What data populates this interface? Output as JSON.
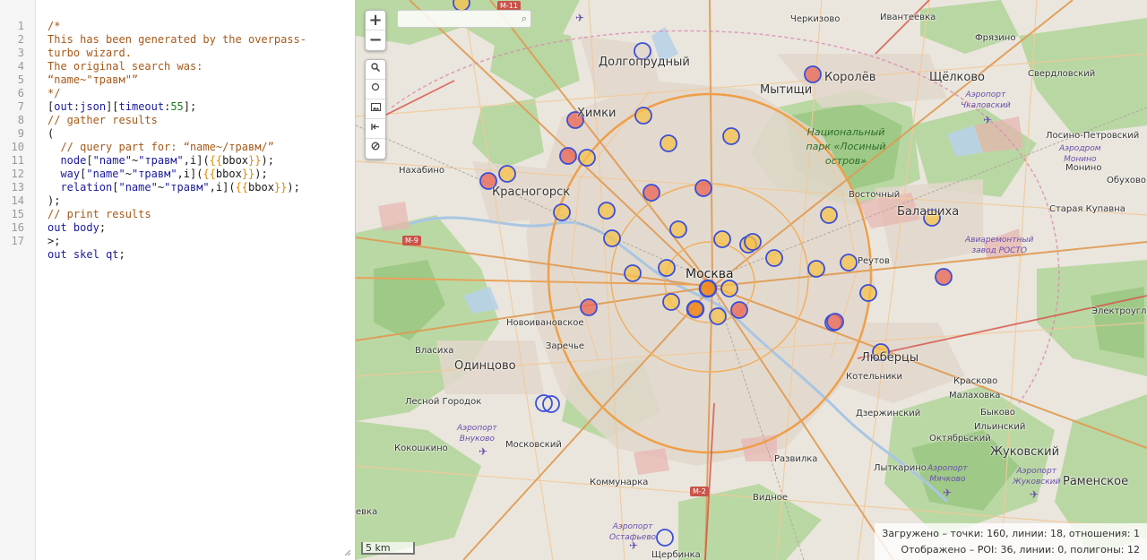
{
  "editor": {
    "line_numbers": [
      "1",
      "2",
      "3",
      "4",
      "5",
      "6",
      "7",
      "8",
      "9",
      "10",
      "11",
      "12",
      "13",
      "14",
      "15",
      "16",
      "17"
    ],
    "lines": [
      [
        {
          "t": "c",
          "v": "/*"
        }
      ],
      [
        {
          "t": "c",
          "v": "This has been generated by the overpass-"
        }
      ],
      [
        {
          "t": "c",
          "v": "turbo wizard."
        }
      ],
      [
        {
          "t": "c",
          "v": "The original search was:"
        }
      ],
      [
        {
          "t": "c",
          "v": "“name~\"травм\"”"
        }
      ],
      [
        {
          "t": "c",
          "v": "*/"
        }
      ],
      [
        {
          "t": "t",
          "v": "["
        },
        {
          "t": "k",
          "v": "out"
        },
        {
          "t": "t",
          "v": ":"
        },
        {
          "t": "k",
          "v": "json"
        },
        {
          "t": "t",
          "v": "]["
        },
        {
          "t": "k",
          "v": "timeout"
        },
        {
          "t": "t",
          "v": ":"
        },
        {
          "t": "n",
          "v": "55"
        },
        {
          "t": "t",
          "v": "];"
        }
      ],
      [
        {
          "t": "c",
          "v": "// gather results"
        }
      ],
      [
        {
          "t": "t",
          "v": "("
        }
      ],
      [
        {
          "t": "t",
          "v": "  "
        },
        {
          "t": "c",
          "v": "// query part for: “name~/травм/”"
        }
      ],
      [
        {
          "t": "t",
          "v": "  "
        },
        {
          "t": "k",
          "v": "node"
        },
        {
          "t": "t",
          "v": "["
        },
        {
          "t": "s",
          "v": "\"name\""
        },
        {
          "t": "t",
          "v": "~"
        },
        {
          "t": "s",
          "v": "\"травм\""
        },
        {
          "t": "t",
          "v": ",i]("
        },
        {
          "t": "tb",
          "v": "{{"
        },
        {
          "t": "t",
          "v": "bbox"
        },
        {
          "t": "tb",
          "v": "}}"
        },
        {
          "t": "t",
          "v": ");"
        }
      ],
      [
        {
          "t": "t",
          "v": "  "
        },
        {
          "t": "k",
          "v": "way"
        },
        {
          "t": "t",
          "v": "["
        },
        {
          "t": "s",
          "v": "\"name\""
        },
        {
          "t": "t",
          "v": "~"
        },
        {
          "t": "s",
          "v": "\"травм\""
        },
        {
          "t": "t",
          "v": ",i]("
        },
        {
          "t": "tb",
          "v": "{{"
        },
        {
          "t": "t",
          "v": "bbox"
        },
        {
          "t": "tb",
          "v": "}}"
        },
        {
          "t": "t",
          "v": ");"
        }
      ],
      [
        {
          "t": "t",
          "v": "  "
        },
        {
          "t": "k",
          "v": "relation"
        },
        {
          "t": "t",
          "v": "["
        },
        {
          "t": "s",
          "v": "\"name\""
        },
        {
          "t": "t",
          "v": "~"
        },
        {
          "t": "s",
          "v": "\"травм\""
        },
        {
          "t": "t",
          "v": ",i]("
        },
        {
          "t": "tb",
          "v": "{{"
        },
        {
          "t": "t",
          "v": "bbox"
        },
        {
          "t": "tb",
          "v": "}}"
        },
        {
          "t": "t",
          "v": ");"
        }
      ],
      [
        {
          "t": "t",
          "v": ");"
        }
      ],
      [
        {
          "t": "c",
          "v": "// print results"
        }
      ],
      [
        {
          "t": "k",
          "v": "out"
        },
        {
          "t": "t",
          "v": " "
        },
        {
          "t": "k",
          "v": "body"
        },
        {
          "t": "t",
          "v": ";"
        }
      ],
      [
        {
          "t": "t",
          "v": ">;"
        }
      ],
      [
        {
          "t": "k",
          "v": "out"
        },
        {
          "t": "t",
          "v": " "
        },
        {
          "t": "k",
          "v": "skel"
        },
        {
          "t": "t",
          "v": " "
        },
        {
          "t": "k",
          "v": "qt"
        },
        {
          "t": "t",
          "v": ";"
        }
      ]
    ]
  },
  "map": {
    "zoom_in": "+",
    "zoom_out": "−",
    "tool_icons": [
      "search-icon",
      "circle-icon",
      "image-icon",
      "first-page-icon",
      "block-icon"
    ],
    "search_placeholder": "",
    "scale_label": "5 km",
    "status": {
      "loaded": "Загружено – точки: 160, линии: 18, отношения: 1",
      "displayed": "Отображено – POI: 36, линии: 0, полигоны: 12"
    },
    "labels": {
      "city_center": "Москва",
      "dolgoprudny": "Долгопрудный",
      "mytishchi": "Мытищи",
      "korolev": "Королёв",
      "shchelkovo": "Щёлково",
      "khimki": "Химки",
      "krasnogorsk": "Красногорск",
      "balashikha": "Балашиха",
      "odintsovo": "Одинцово",
      "lyubertsy": "Люберцы",
      "zhukovsky": "Жуковский",
      "ramenskoye": "Раменское",
      "cherkizovo": "Черкизово",
      "ivanteevka": "Ивантеевка",
      "fryazino": "Фрязино",
      "sverdlovsky": "Свердловский",
      "losino": "Лосино-Петровский",
      "monino": "Монино",
      "obukhovo": "Обухово",
      "staraya_kupavna": "Старая Купавна",
      "vostochny": "Восточный",
      "reutov": "Реутов",
      "elektrougli": "Электроугли",
      "kotelniki": "Котельники",
      "krasnovo": "Красково",
      "malakhovka": "Малаховка",
      "dzerzhinsky": "Дзержинский",
      "bykovo": "Быково",
      "ilinsky": "Ильинский",
      "oktyabrsky": "Октябрьский",
      "lytkarino": "Лыткарино",
      "razvilka": "Развилка",
      "vidnoe": "Видное",
      "kommunarka": "Коммунарка",
      "moskovsky": "Московский",
      "kokoshkino": "Кокошкино",
      "lesnoy_gorodok": "Лесной Городок",
      "vlasikha": "Власиха",
      "zarechye": "Заречье",
      "novoivanovskoe": "Новоивановское",
      "nakhabino": "Нахабино",
      "shcherbinka": "Щербинка",
      "vnukovo_rd": "евка",
      "park_losiny": "Национальный\nпарк «Лосиный\nостров»",
      "airport_chkalovsky": "Аэропорт\nЧкаловский",
      "airport_vnukovo": "Аэропорт\nВнуково",
      "airport_ostafyevo": "Аэропорт\nОстафьево",
      "airport_myachkovo": "Аэропорт\nМячково",
      "airport_zhukovsky": "Аэропорт\nЖуковский",
      "aerodrome_monino": "Аэродром\nМонино",
      "aviarepair": "Авиаремонтный\nзавод РОСТО",
      "road_m11": "М-11",
      "road_m9": "М-9",
      "road_m2": "М-2"
    },
    "colors": {
      "poi_stroke": "#3b4fd8",
      "poi_fill": "#f5c24a",
      "poi_fill_red": "#e86a5a",
      "poi_fill_orange": "#f08a1e",
      "ring_road": "#f0a24a",
      "forest": "#a9d08e",
      "urban": "#e5dcd1"
    }
  }
}
